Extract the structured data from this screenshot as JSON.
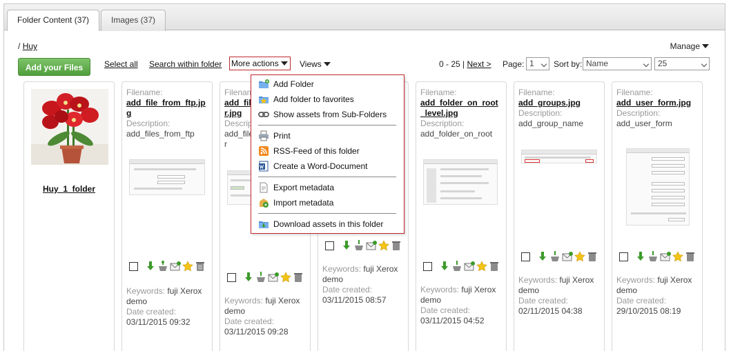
{
  "tabs": [
    {
      "label": "Folder Content (37)",
      "active": true
    },
    {
      "label": "Images (37)",
      "active": false
    }
  ],
  "breadcrumb": {
    "separator": "/",
    "current": "Huy"
  },
  "manage_label": "Manage",
  "toolbar": {
    "add_files": "Add your Files",
    "select_all": "Select all",
    "search_within": "Search within folder",
    "more_actions": "More actions",
    "views": "Views"
  },
  "paging": {
    "range": "0 - 25 |",
    "next": "Next >",
    "page_label": "Page:",
    "page_value": "1",
    "sort_label": "Sort by:",
    "sort_value": "Name",
    "per_page_value": "25"
  },
  "menu": {
    "items": [
      {
        "label": "Add Folder",
        "icon": "add-folder-icon"
      },
      {
        "label": "Add folder to favorites",
        "icon": "favorite-folder-icon"
      },
      {
        "label": "Show assets from Sub-Folders",
        "icon": "link-icon"
      },
      {
        "label": "Print",
        "icon": "printer-icon"
      },
      {
        "label": "RSS-Feed of this folder",
        "icon": "rss-icon"
      },
      {
        "label": "Create a Word-Document",
        "icon": "word-icon"
      },
      {
        "label": "Export metadata",
        "icon": "export-icon"
      },
      {
        "label": "Import metadata",
        "icon": "import-icon"
      },
      {
        "label": "Download assets in this folder",
        "icon": "download-folder-icon"
      }
    ]
  },
  "folder_card": {
    "name": "Huy_1_folder"
  },
  "labels": {
    "filename": "Filename:",
    "description": "Description:",
    "keywords": "Keywords:",
    "date_created": "Date created:"
  },
  "cards": [
    {
      "filename": "add_file_from_ftp.jpg",
      "description": "add_files_from_ftp",
      "keywords": "fuji Xerox demo",
      "date": "03/11/2015 09:32"
    },
    {
      "filename": "add_file_from_ftp_2r.jpg",
      "description": "add_file_from_ftp_2r",
      "keywords": "fuji Xerox demo",
      "date": "03/11/2015 09:28"
    },
    {
      "filename": "",
      "description": "",
      "keywords": "fuji Xerox demo",
      "date": "03/11/2015 08:57"
    },
    {
      "filename": "add_folder_on_root_level.jpg",
      "description": "add_folder_on_root",
      "keywords": "fuji Xerox demo",
      "date": "03/11/2015 04:52"
    },
    {
      "filename": "add_groups.jpg",
      "description": "add_group_name",
      "keywords": "fuji Xerox demo",
      "date": "02/11/2015 04:38"
    },
    {
      "filename": "add_user_form.jpg",
      "description": "add_user_form",
      "keywords": "fuji Xerox demo",
      "date": "29/10/2015 08:19"
    }
  ],
  "partial_card_texts": {
    "filename_lines": [
      "add_fil",
      "r.jpg"
    ],
    "description_lines": [
      "add_file",
      "r"
    ]
  },
  "colors": {
    "accent_green": "#5aa845",
    "menu_border": "#c0272d",
    "star": "#f3c318"
  }
}
